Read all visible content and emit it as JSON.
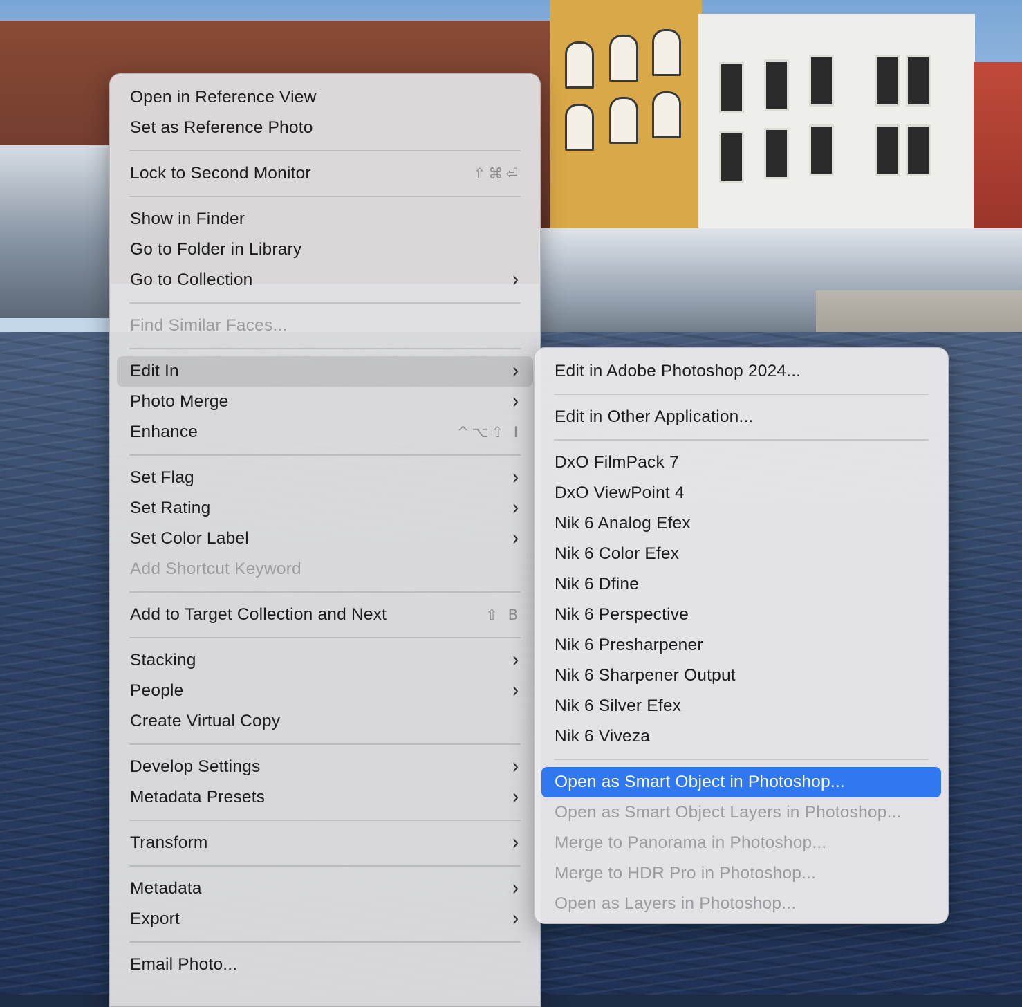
{
  "context_menu": {
    "groups": [
      [
        {
          "label": "Open in Reference View"
        },
        {
          "label": "Set as Reference Photo"
        }
      ],
      [
        {
          "label": "Lock to Second Monitor",
          "shortcut": "⇧⌘⏎"
        }
      ],
      [
        {
          "label": "Show in Finder"
        },
        {
          "label": "Go to Folder in Library"
        },
        {
          "label": "Go to Collection",
          "submenu": true
        }
      ],
      [
        {
          "label": "Find Similar Faces...",
          "disabled": true
        }
      ],
      [
        {
          "label": "Edit In",
          "submenu": true,
          "highlighted": true
        },
        {
          "label": "Photo Merge",
          "submenu": true
        },
        {
          "label": "Enhance",
          "shortcut": "^⌥⇧ I"
        }
      ],
      [
        {
          "label": "Set Flag",
          "submenu": true
        },
        {
          "label": "Set Rating",
          "submenu": true
        },
        {
          "label": "Set Color Label",
          "submenu": true
        },
        {
          "label": "Add Shortcut Keyword",
          "disabled": true
        }
      ],
      [
        {
          "label": "Add to Target Collection and Next",
          "shortcut": "⇧ B"
        }
      ],
      [
        {
          "label": "Stacking",
          "submenu": true
        },
        {
          "label": "People",
          "submenu": true
        },
        {
          "label": "Create Virtual Copy"
        }
      ],
      [
        {
          "label": "Develop Settings",
          "submenu": true
        },
        {
          "label": "Metadata Presets",
          "submenu": true
        }
      ],
      [
        {
          "label": "Transform",
          "submenu": true
        }
      ],
      [
        {
          "label": "Metadata",
          "submenu": true
        },
        {
          "label": "Export",
          "submenu": true
        }
      ],
      [
        {
          "label": "Email Photo..."
        }
      ]
    ]
  },
  "edit_in_submenu": {
    "groups": [
      [
        {
          "label": "Edit in Adobe Photoshop 2024..."
        }
      ],
      [
        {
          "label": "Edit in Other Application..."
        }
      ],
      [
        {
          "label": "DxO FilmPack 7"
        },
        {
          "label": "DxO ViewPoint 4"
        },
        {
          "label": "Nik 6 Analog Efex"
        },
        {
          "label": "Nik 6 Color Efex"
        },
        {
          "label": "Nik 6 Dfine"
        },
        {
          "label": "Nik 6 Perspective"
        },
        {
          "label": "Nik 6 Presharpener"
        },
        {
          "label": "Nik 6 Sharpener Output"
        },
        {
          "label": "Nik 6 Silver Efex"
        },
        {
          "label": "Nik 6 Viveza"
        }
      ],
      [
        {
          "label": "Open as Smart Object in Photoshop...",
          "selected": true
        },
        {
          "label": "Open as Smart Object Layers in Photoshop...",
          "disabled": true
        },
        {
          "label": "Merge to Panorama in Photoshop...",
          "disabled": true
        },
        {
          "label": "Merge to HDR Pro in Photoshop...",
          "disabled": true
        },
        {
          "label": "Open as Layers in Photoshop...",
          "disabled": true
        }
      ]
    ]
  },
  "icons": {
    "submenu_arrow": "chevron-right-icon",
    "chevron_glyph": "›"
  },
  "colors": {
    "selection": "#2f78f0",
    "hover": "rgba(0,0,0,0.10)",
    "disabled_text": "#9c9ca0"
  }
}
